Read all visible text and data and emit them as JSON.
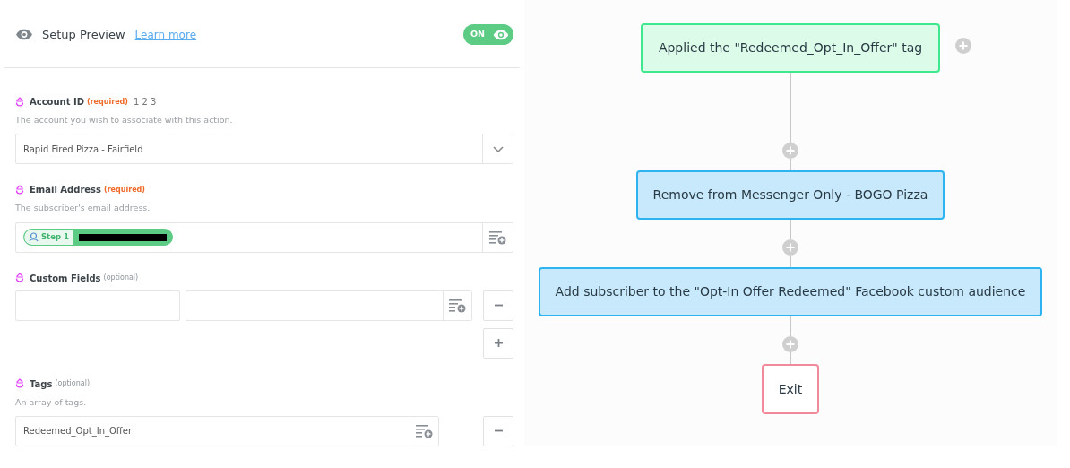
{
  "header": {
    "title": "Setup Preview",
    "link": "Learn more",
    "toggle": {
      "label": "ON",
      "on": true
    }
  },
  "fields": [
    {
      "kind": "select",
      "label": "Account ID",
      "requirement": "(required)",
      "required": true,
      "extra": "1 2 3",
      "description": "The account you wish to associate with this action.",
      "value": "Rapid Fired Pizza - Fairfield"
    },
    {
      "kind": "token",
      "label": "Email Address",
      "requirement": "(required)",
      "required": true,
      "description": "The subscriber's email address.",
      "token": "Step 1"
    },
    {
      "kind": "pairs",
      "label": "Custom Fields",
      "requirement": "(optional)",
      "required": false
    },
    {
      "kind": "list",
      "label": "Tags",
      "requirement": "(optional)",
      "required": false,
      "description": "An array of tags.",
      "value": "Redeemed_Opt_In_Offer"
    }
  ],
  "flow": [
    {
      "kind": "tag",
      "text": "Applied the \"Redeemed_Opt_In_Offer\" tag"
    },
    {
      "kind": "action",
      "text": "Remove from Messenger Only - BOGO Pizza"
    },
    {
      "kind": "action",
      "text": "Add subscriber to the \"Opt-In Offer Redeemed\" Facebook custom audience"
    },
    {
      "kind": "exit",
      "text": "Exit"
    }
  ]
}
